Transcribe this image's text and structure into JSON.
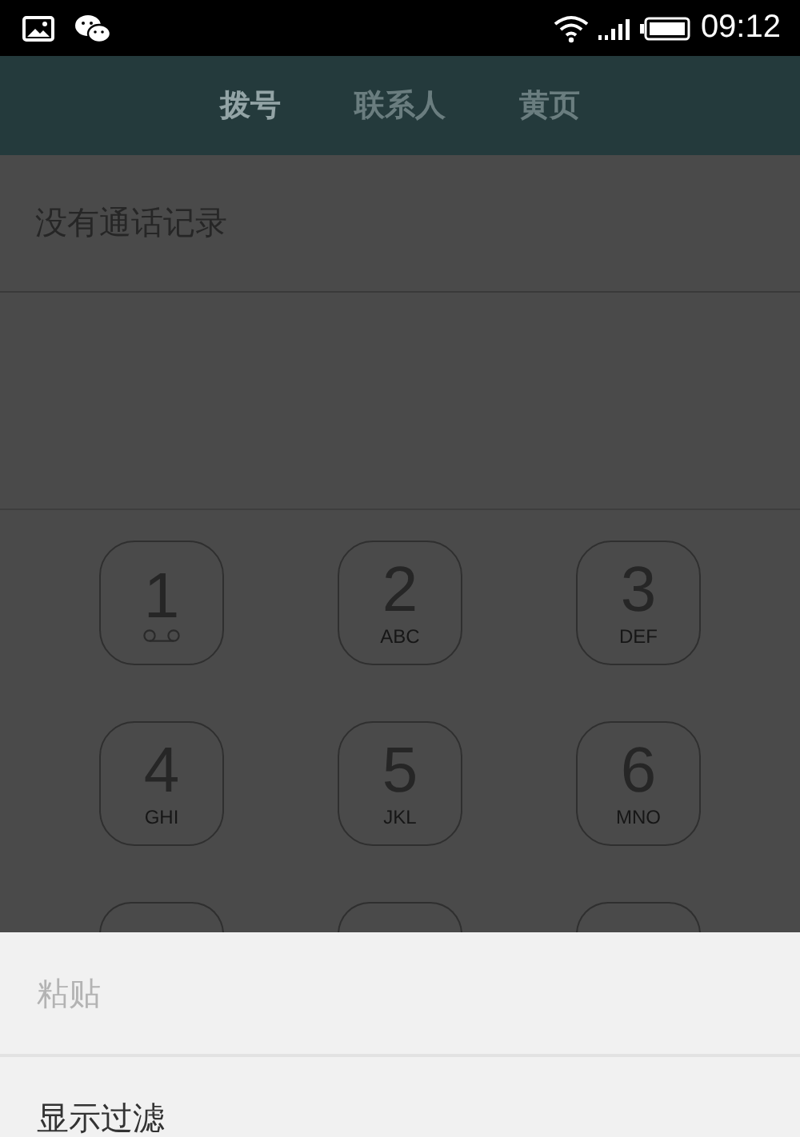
{
  "status_bar": {
    "time": "09:12"
  },
  "tabs": [
    {
      "label": "拨号",
      "selected": true
    },
    {
      "label": "联系人",
      "selected": false
    },
    {
      "label": "黄页",
      "selected": false
    }
  ],
  "call_log": {
    "empty_message": "没有通话记录"
  },
  "keypad": [
    {
      "kind": "voicemail",
      "digit": "1"
    },
    {
      "kind": "letters",
      "digit": "2",
      "letters": "ABC"
    },
    {
      "kind": "letters",
      "digit": "3",
      "letters": "DEF"
    },
    {
      "kind": "letters",
      "digit": "4",
      "letters": "GHI"
    },
    {
      "kind": "letters",
      "digit": "5",
      "letters": "JKL"
    },
    {
      "kind": "letters",
      "digit": "6",
      "letters": "MNO"
    },
    {
      "kind": "partial"
    },
    {
      "kind": "partial"
    },
    {
      "kind": "partial"
    }
  ],
  "menu": [
    {
      "label": "粘贴",
      "disabled": true
    },
    {
      "label": "显示过滤",
      "disabled": false
    }
  ]
}
